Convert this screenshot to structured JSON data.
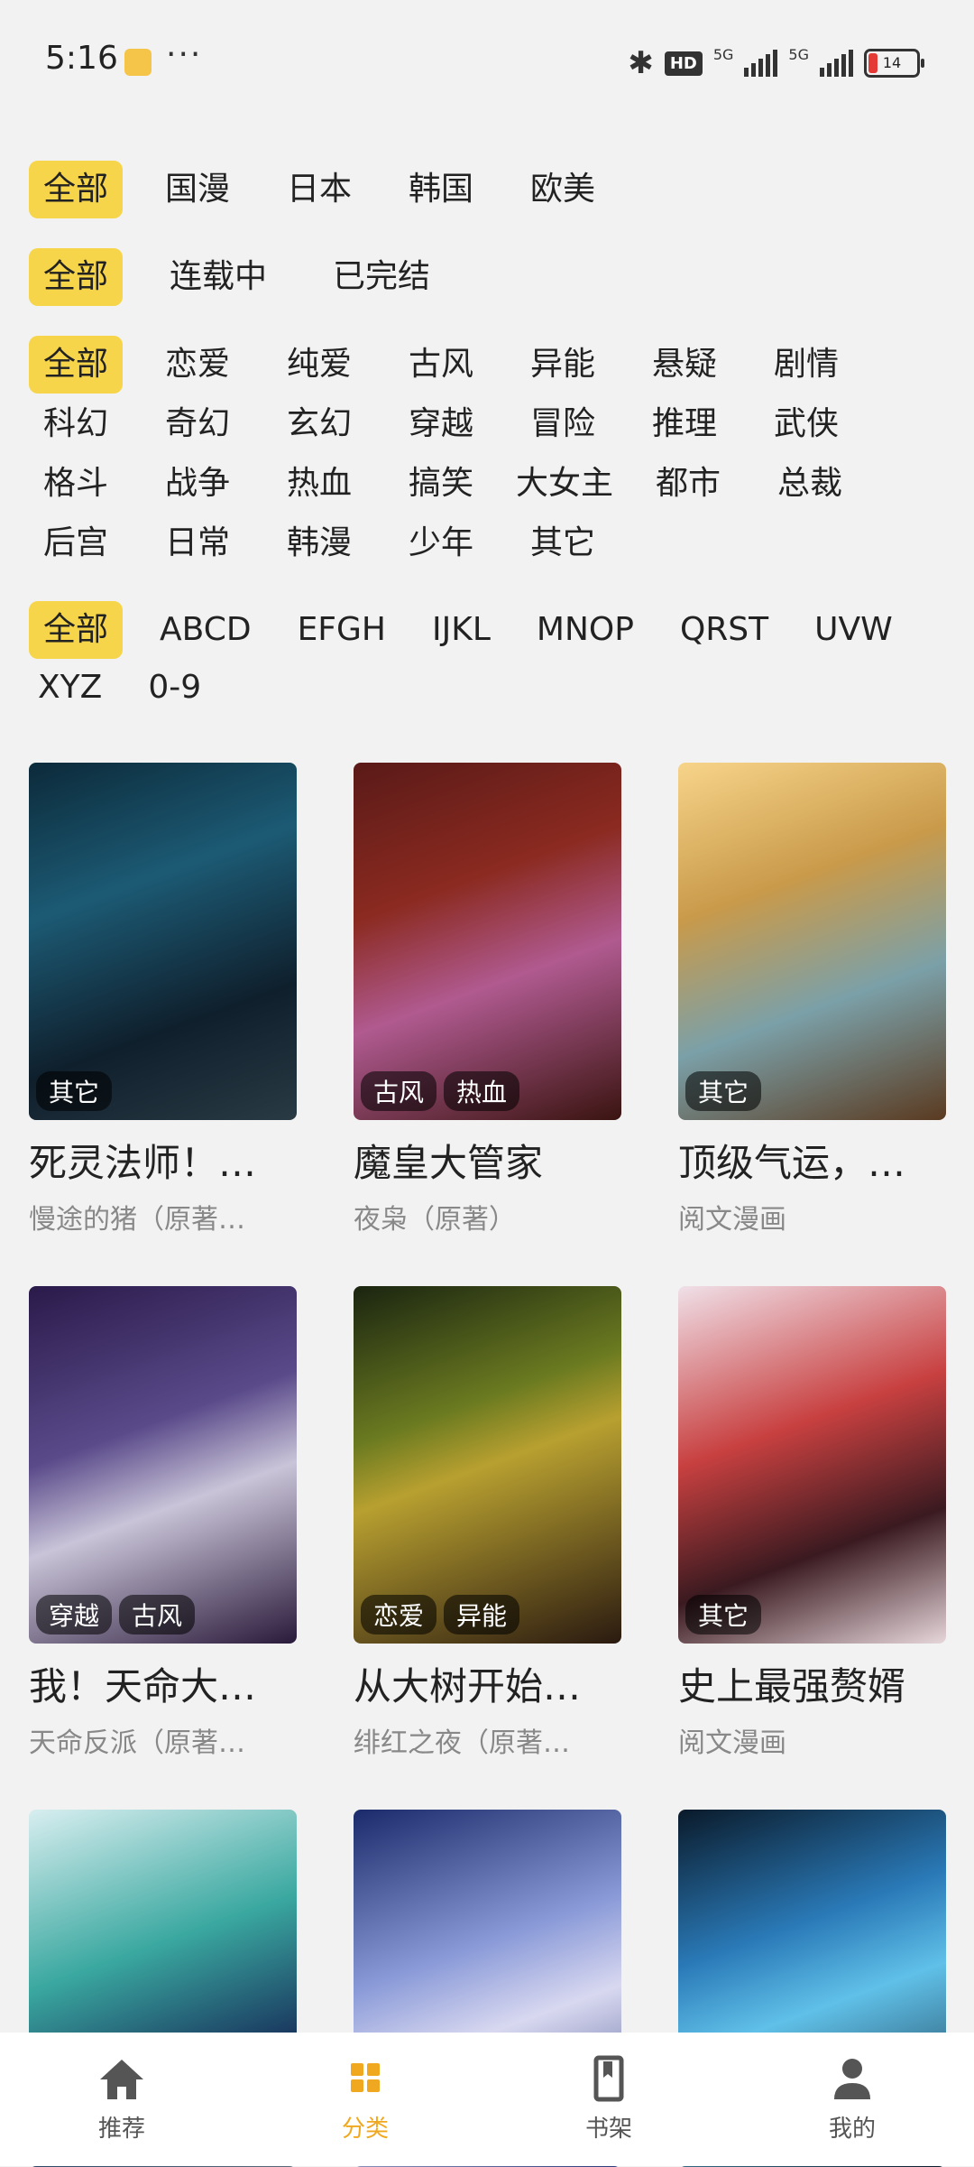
{
  "status_bar": {
    "time": "5:16",
    "dots": "···",
    "hd": "HD",
    "net1": "5G",
    "net2": "5G",
    "battery": "14"
  },
  "filters": {
    "region": [
      "全部",
      "国漫",
      "日本",
      "韩国",
      "欧美"
    ],
    "status": [
      "全部",
      "连载中",
      "已完结"
    ],
    "genre": [
      "全部",
      "恋爱",
      "纯爱",
      "古风",
      "异能",
      "悬疑",
      "剧情",
      "科幻",
      "奇幻",
      "玄幻",
      "穿越",
      "冒险",
      "推理",
      "武侠",
      "格斗",
      "战争",
      "热血",
      "搞笑",
      "大女主",
      "都市",
      "总裁",
      "后宫",
      "日常",
      "韩漫",
      "少年",
      "其它"
    ],
    "letter": [
      "全部",
      "ABCD",
      "EFGH",
      "IJKL",
      "MNOP",
      "QRST",
      "UVW",
      "XYZ",
      "0-9"
    ]
  },
  "comics": [
    {
      "title": "死灵法师！…",
      "author": "慢途的猪（原著…",
      "tags": [
        "其它"
      ]
    },
    {
      "title": "魔皇大管家",
      "author": "夜枭（原著）",
      "tags": [
        "古风",
        "热血"
      ]
    },
    {
      "title": "顶级气运，…",
      "author": "阅文漫画",
      "tags": [
        "其它"
      ]
    },
    {
      "title": "我！天命大…",
      "author": "天命反派（原著…",
      "tags": [
        "穿越",
        "古风"
      ]
    },
    {
      "title": "从大树开始…",
      "author": "绯红之夜（原著…",
      "tags": [
        "恋爱",
        "异能"
      ]
    },
    {
      "title": "史上最强赘婿",
      "author": "阅文漫画",
      "tags": [
        "其它"
      ]
    },
    {
      "title": "",
      "author": "",
      "tags": []
    },
    {
      "title": "",
      "author": "",
      "tags": []
    },
    {
      "title": "",
      "author": "",
      "tags": []
    }
  ],
  "nav": [
    {
      "label": "推荐",
      "icon": "home-icon"
    },
    {
      "label": "分类",
      "icon": "grid-icon"
    },
    {
      "label": "书架",
      "icon": "bookmark-icon"
    },
    {
      "label": "我的",
      "icon": "user-icon"
    }
  ],
  "colors": {
    "accent": "#f6d54a",
    "nav_active": "#f0a820",
    "background": "#f2f2f2"
  }
}
